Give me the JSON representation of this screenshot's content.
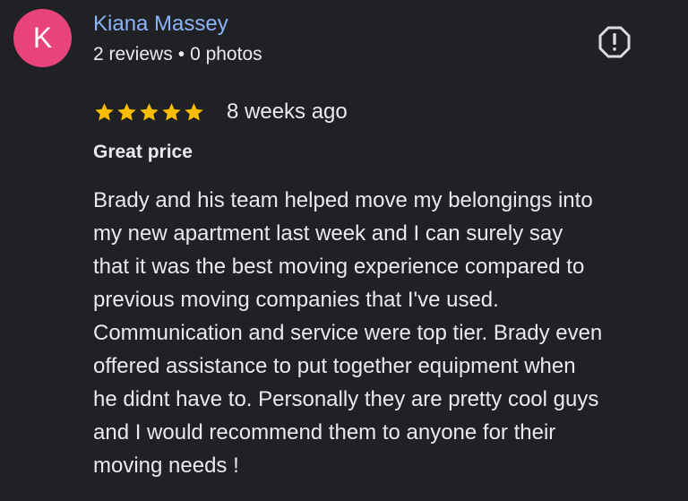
{
  "reviewer": {
    "initial": "K",
    "name": "Kiana Massey",
    "reviews": "2 reviews",
    "separator": "•",
    "photos": "0 photos",
    "avatar_color": "#e8437a"
  },
  "report": {
    "icon": "report-flag-icon"
  },
  "review": {
    "rating": 5,
    "max_rating": 5,
    "star_color": "#fbbc04",
    "time_ago": "8 weeks ago",
    "title": "Great price",
    "body_lines": [
      "Brady and his team helped move my belongings into",
      "my new apartment last week and I can surely say",
      "that it was the best moving experience compared to",
      "previous moving companies that I've used.",
      "Communication and service were top tier. Brady even",
      "offered assistance to put together equipment when",
      "he didnt have to. Personally they are pretty cool guys",
      "and I would recommend them to anyone for their",
      "moving needs !"
    ]
  }
}
